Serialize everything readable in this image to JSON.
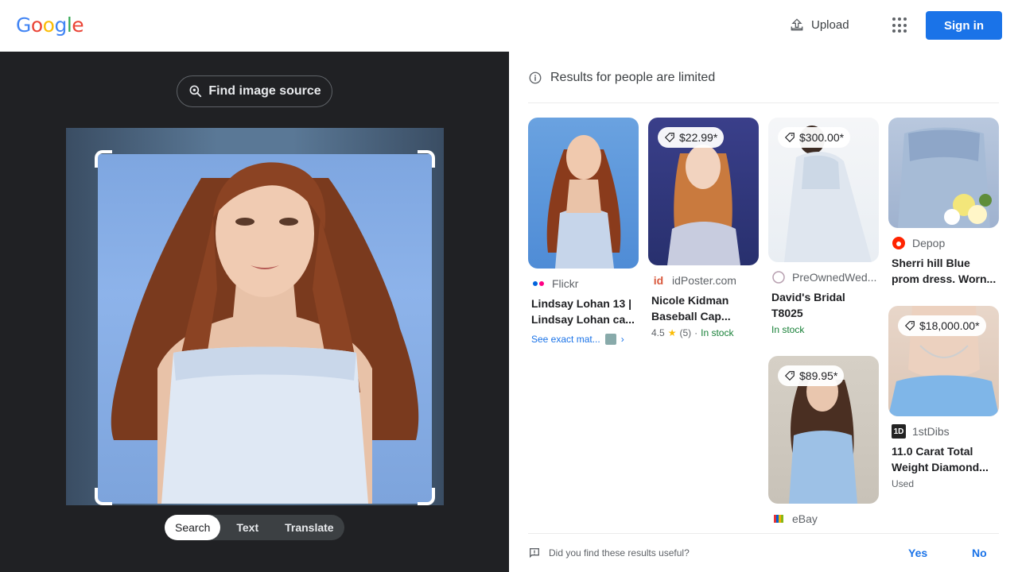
{
  "header": {
    "logo_letters": [
      {
        "ch": "G",
        "color": "#4285F4"
      },
      {
        "ch": "o",
        "color": "#EA4335"
      },
      {
        "ch": "o",
        "color": "#FBBC05"
      },
      {
        "ch": "g",
        "color": "#4285F4"
      },
      {
        "ch": "l",
        "color": "#34A853"
      },
      {
        "ch": "e",
        "color": "#EA4335"
      }
    ],
    "upload_label": "Upload",
    "signin_label": "Sign in"
  },
  "lens": {
    "find_source_label": "Find image source",
    "modes": [
      {
        "label": "Search",
        "active": true
      },
      {
        "label": "Text",
        "active": false
      },
      {
        "label": "Translate",
        "active": false
      }
    ]
  },
  "results": {
    "notice": "Results for people are limited",
    "cards": [
      {
        "source": "Flickr",
        "favicon": "flickr-icon",
        "title_line1": "Lindsay Lohan 13 |",
        "title_line2": "Lindsay Lohan ca...",
        "exact_label": "See exact mat...",
        "price": ""
      },
      {
        "source": "idPoster.com",
        "favicon": "idposter-icon",
        "title_line1": "Nicole Kidman",
        "title_line2": "Baseball Cap...",
        "rating": "4.5",
        "review_count": "(5)",
        "stock": "In stock",
        "price": "$22.99*"
      },
      {
        "source": "PreOwnedWed...",
        "favicon": "preownedwed-icon",
        "title_line1": "David's Bridal",
        "title_line2": "T8025",
        "stock": "In stock",
        "price": "$300.00*"
      },
      {
        "source": "Depop",
        "favicon": "depop-icon",
        "title_line1": "Sherri hill Blue",
        "title_line2": "prom dress. Worn...",
        "price": ""
      },
      {
        "source": "eBay",
        "favicon": "ebay-icon",
        "price": "$89.95*"
      },
      {
        "source": "1stDibs",
        "favicon": "1stdibs-icon",
        "title_line1": "11.0 Carat Total",
        "title_line2": "Weight Diamond...",
        "condition": "Used",
        "price": "$18,000.00*"
      }
    ],
    "feedback_question": "Did you find these results useful?",
    "feedback_yes": "Yes",
    "feedback_no": "No"
  }
}
